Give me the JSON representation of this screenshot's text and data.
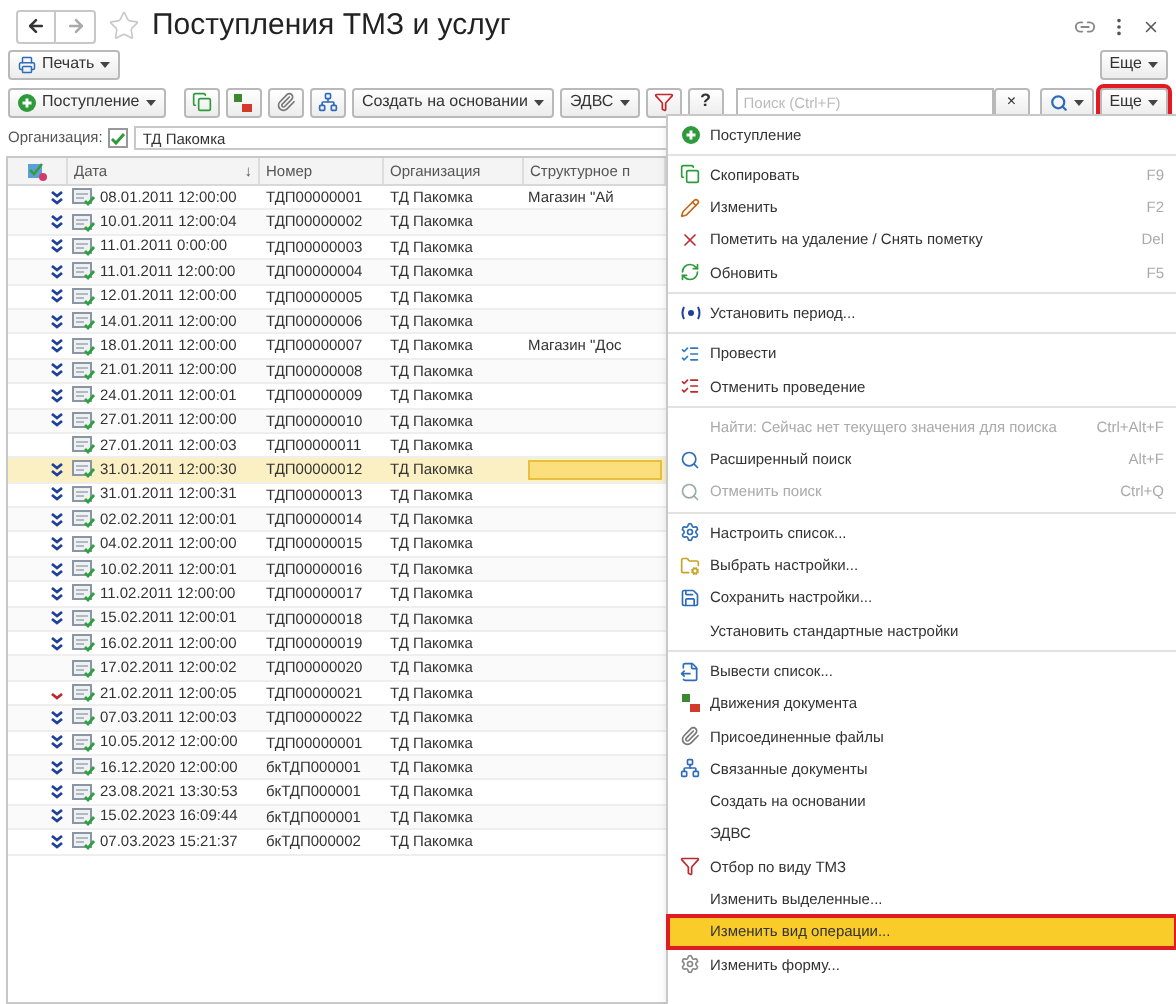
{
  "window": {
    "title": "Поступления ТМЗ и услуг"
  },
  "print_button": {
    "label": "Печать"
  },
  "more_button_top": {
    "label": "Еще"
  },
  "toolbar": {
    "add_button": {
      "label": "Поступление"
    },
    "create_based_button": {
      "label": "Создать на основании"
    },
    "edvs_button": {
      "label": "ЭДВС"
    },
    "help_button": {
      "label": "?"
    },
    "search": {
      "placeholder": "Поиск (Ctrl+F)",
      "clear": "×"
    },
    "more_button": {
      "label": "Еще",
      "annotated": true
    }
  },
  "filter": {
    "label": "Организация:",
    "checked": true,
    "value": "ТД Пакомка"
  },
  "table": {
    "columns": [
      "Дата",
      "Номер",
      "Организация",
      "Структурное п"
    ],
    "sort_mark": "↓",
    "rows": [
      {
        "kind": "posted",
        "date": "08.01.2011 12:00:00",
        "number": "ТДП00000001",
        "org": "ТД Пакомка",
        "unit": "Магазин \"Ай",
        "selected": false
      },
      {
        "kind": "posted",
        "date": "10.01.2011 12:00:04",
        "number": "ТДП00000002",
        "org": "ТД Пакомка",
        "selected": false
      },
      {
        "kind": "posted",
        "date": "11.01.2011 0:00:00",
        "number": "ТДП00000003",
        "org": "ТД Пакомка",
        "selected": false
      },
      {
        "kind": "posted",
        "date": "11.01.2011 12:00:00",
        "number": "ТДП00000004",
        "org": "ТД Пакомка",
        "selected": false
      },
      {
        "kind": "posted",
        "date": "12.01.2011 12:00:00",
        "number": "ТДП00000005",
        "org": "ТД Пакомка",
        "selected": false
      },
      {
        "kind": "posted",
        "date": "14.01.2011 12:00:00",
        "number": "ТДП00000006",
        "org": "ТД Пакомка",
        "selected": false
      },
      {
        "kind": "posted",
        "date": "18.01.2011 12:00:00",
        "number": "ТДП00000007",
        "org": "ТД Пакомка",
        "unit": "Магазин \"Дос",
        "selected": false
      },
      {
        "kind": "posted",
        "date": "21.01.2011 12:00:00",
        "number": "ТДП00000008",
        "org": "ТД Пакомка",
        "selected": false
      },
      {
        "kind": "posted",
        "date": "24.01.2011 12:00:01",
        "number": "ТДП00000009",
        "org": "ТД Пакомка",
        "selected": false
      },
      {
        "kind": "posted",
        "date": "27.01.2011 12:00:00",
        "number": "ТДП00000010",
        "org": "ТД Пакомка",
        "selected": false
      },
      {
        "kind": "none",
        "date": "27.01.2011 12:00:03",
        "number": "ТДП00000011",
        "org": "ТД Пакомка",
        "selected": false
      },
      {
        "kind": "posted",
        "date": "31.01.2011 12:00:30",
        "number": "ТДП00000012",
        "org": "ТД Пакомка",
        "selected": true
      },
      {
        "kind": "posted",
        "date": "31.01.2011 12:00:31",
        "number": "ТДП00000013",
        "org": "ТД Пакомка",
        "selected": false
      },
      {
        "kind": "posted",
        "date": "02.02.2011 12:00:01",
        "number": "ТДП00000014",
        "org": "ТД Пакомка",
        "selected": false
      },
      {
        "kind": "posted",
        "date": "04.02.2011 12:00:00",
        "number": "ТДП00000015",
        "org": "ТД Пакомка",
        "selected": false
      },
      {
        "kind": "posted",
        "date": "10.02.2011 12:00:01",
        "number": "ТДП00000016",
        "org": "ТД Пакомка",
        "selected": false
      },
      {
        "kind": "posted",
        "date": "11.02.2011 12:00:00",
        "number": "ТДП00000017",
        "org": "ТД Пакомка",
        "selected": false
      },
      {
        "kind": "posted",
        "date": "15.02.2011 12:00:01",
        "number": "ТДП00000018",
        "org": "ТД Пакомка",
        "selected": false
      },
      {
        "kind": "posted",
        "date": "16.02.2011 12:00:00",
        "number": "ТДП00000019",
        "org": "ТД Пакомка",
        "selected": false
      },
      {
        "kind": "none",
        "date": "17.02.2011 12:00:02",
        "number": "ТДП00000020",
        "org": "ТД Пакомка",
        "selected": false
      },
      {
        "kind": "red",
        "date": "21.02.2011 12:00:05",
        "number": "ТДП00000021",
        "org": "ТД Пакомка",
        "selected": false
      },
      {
        "kind": "posted",
        "date": "07.03.2011 12:00:03",
        "number": "ТДП00000022",
        "org": "ТД Пакомка",
        "selected": false
      },
      {
        "kind": "posted",
        "date": "10.05.2012 12:00:00",
        "number": "ТДП00000001",
        "org": "ТД Пакомка",
        "selected": false
      },
      {
        "kind": "posted",
        "date": "16.12.2020 12:00:00",
        "number": "бкТДП000001",
        "org": "ТД Пакомка",
        "selected": false
      },
      {
        "kind": "posted",
        "date": "23.08.2021 13:30:53",
        "number": "бкТДП000001",
        "org": "ТД Пакомка",
        "selected": false
      },
      {
        "kind": "posted",
        "date": "15.02.2023 16:09:44",
        "number": "бкТДП000001",
        "org": "ТД Пакомка",
        "selected": false
      },
      {
        "kind": "posted",
        "date": "07.03.2023 15:21:37",
        "number": "бкТДП000002",
        "org": "ТД Пакомка",
        "selected": false
      }
    ]
  },
  "menu": {
    "groups": [
      [
        {
          "label": "Поступление",
          "disabled": false,
          "selected": false
        }
      ],
      [
        {
          "label": "Скопировать",
          "shortcut": "F9",
          "disabled": false,
          "selected": false
        },
        {
          "label": "Изменить",
          "shortcut": "F2",
          "disabled": false,
          "selected": false
        },
        {
          "label": "Пометить на удаление / Снять пометку",
          "shortcut": "Del",
          "disabled": false,
          "selected": false
        },
        {
          "label": "Обновить",
          "shortcut": "F5",
          "disabled": false,
          "selected": false
        }
      ],
      [
        {
          "label": "Установить период...",
          "disabled": false,
          "selected": false
        }
      ],
      [
        {
          "label": "Провести",
          "disabled": false,
          "selected": false
        },
        {
          "label": "Отменить проведение",
          "disabled": false,
          "selected": false
        }
      ],
      [
        {
          "label": "Найти: Сейчас нет текущего значения для поиска",
          "shortcut": "Ctrl+Alt+F",
          "disabled": true,
          "selected": false
        },
        {
          "label": "Расширенный поиск",
          "shortcut": "Alt+F",
          "disabled": false,
          "selected": false
        },
        {
          "label": "Отменить поиск",
          "shortcut": "Ctrl+Q",
          "disabled": true,
          "selected": false
        }
      ],
      [
        {
          "label": "Настроить список...",
          "disabled": false,
          "selected": false
        },
        {
          "label": "Выбрать настройки...",
          "disabled": false,
          "selected": false
        },
        {
          "label": "Сохранить настройки...",
          "disabled": false,
          "selected": false
        },
        {
          "label": "Установить стандартные настройки",
          "disabled": false,
          "selected": false
        }
      ],
      [
        {
          "label": "Вывести список...",
          "disabled": false,
          "selected": false
        },
        {
          "label": "Движения документа",
          "disabled": false,
          "selected": false
        },
        {
          "label": "Присоединенные файлы",
          "disabled": false,
          "selected": false
        },
        {
          "label": "Связанные документы",
          "disabled": false,
          "selected": false
        },
        {
          "label": "Создать на основании",
          "disabled": false,
          "selected": false
        },
        {
          "label": "ЭДВС",
          "disabled": false,
          "selected": false
        },
        {
          "label": "Отбор по виду ТМЗ",
          "disabled": false,
          "selected": false
        },
        {
          "label": "Изменить выделенные...",
          "disabled": false,
          "selected": false
        },
        {
          "label": "Изменить вид операции...",
          "disabled": false,
          "selected": true,
          "annotated": true
        },
        {
          "label": "Изменить форму...",
          "disabled": false,
          "selected": false
        }
      ]
    ]
  }
}
